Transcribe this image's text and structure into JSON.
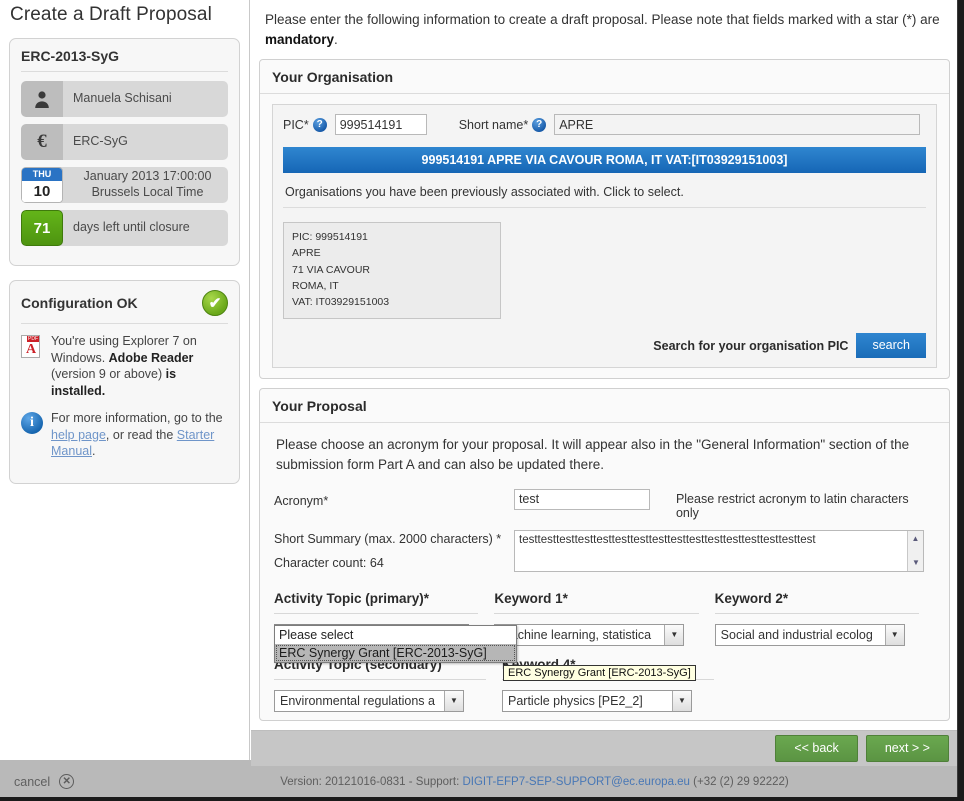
{
  "page": {
    "title": "Create a Draft Proposal"
  },
  "sidebar": {
    "call_panel": {
      "title": "ERC-2013-SyG",
      "rows": [
        {
          "icon": "user-icon",
          "text": "Manuela Schisani"
        },
        {
          "icon": "euro-icon",
          "text": "ERC-SyG"
        },
        {
          "icon": "calendar-icon",
          "weekday": "THU",
          "day": "10",
          "text": "January 2013 17:00:00 Brussels Local Time"
        },
        {
          "icon": "days-left-icon",
          "count": "71",
          "text": "days left until closure"
        }
      ]
    },
    "config_panel": {
      "title": "Configuration OK",
      "badge": "✔",
      "rows": [
        {
          "icon": "pdf-icon",
          "text_prefix": "You're using Explorer 7 on Windows. ",
          "text_bold": "Adobe Reader",
          "text_mid": " (version 9 or above) ",
          "text_bold2": "is installed.",
          "text_suffix": ""
        },
        {
          "icon": "info-icon",
          "text_prefix": "For more information, go to the ",
          "link1": "help page",
          "text_mid": ", or read the ",
          "link2": "Starter Manual",
          "text_suffix": "."
        }
      ]
    }
  },
  "main": {
    "intro_prefix": "Please enter the following information to create a draft proposal. Please note that fields marked with a star (*) are ",
    "intro_bold": "mandatory",
    "intro_suffix": ".",
    "organisation": {
      "heading": "Your Organisation",
      "pic_label": "PIC*",
      "pic_value": "999514191",
      "shortname_label": "Short name*",
      "shortname_value": "APRE",
      "banner": "999514191 APRE VIA CAVOUR ROMA, IT VAT:[IT03929151003]",
      "sub_note": "Organisations you have been previously associated with. Click to select.",
      "org_card": "PIC: 999514191\nAPRE\n71 VIA CAVOUR\nROMA, IT\nVAT: IT03929151003",
      "search_label": "Search for your organisation PIC",
      "search_button": "search"
    },
    "proposal": {
      "heading": "Your Proposal",
      "note": "Please choose an acronym for your proposal. It will appear also in the \"General Information\" section of the submission form Part A and can also be updated there.",
      "acronym_label": "Acronym*",
      "acronym_value": "test",
      "acronym_hint": "Please restrict acronym to latin characters only",
      "summary_label": "Short Summary (max. 2000 characters) *",
      "summary_count": "Character count: 64",
      "summary_value": "testtesttesttesttesttesttesttesttesttesttesttesttesttesttesttest",
      "topics": {
        "row1": [
          {
            "label": "Activity Topic (primary)*",
            "value": "Please select",
            "state": "open"
          },
          {
            "label": "Keyword 1*",
            "value": "Machine learning, statistica",
            "state": "closed"
          },
          {
            "label": "Keyword 2*",
            "value": "Social and industrial ecolog",
            "state": "closed"
          }
        ],
        "row2": [
          {
            "label": "Activity Topic (secondary)",
            "value": "Environmental regulations a",
            "state": "closed"
          },
          {
            "label": "Keyword 4*",
            "value": "Particle physics [PE2_2]",
            "state": "closed"
          }
        ],
        "open_options": [
          {
            "label": "Please select",
            "selected": false
          },
          {
            "label": "ERC Synergy Grant [ERC-2013-SyG]",
            "selected": true
          }
        ],
        "tooltip": "ERC Synergy Grant [ERC-2013-SyG]"
      }
    }
  },
  "actions": {
    "back": "<< back",
    "next": "next > >"
  },
  "footer": {
    "cancel": "cancel",
    "version_prefix": "Version: 20121016-0831 - Support: ",
    "support_email": "DIGIT-EFP7-SEP-SUPPORT@ec.europa.eu",
    "phone": " (+32 (2) 29 92222)"
  },
  "colors": {
    "accent_blue": "#1a6cb8",
    "green": "#5b9443",
    "banner": "#1666b5"
  }
}
